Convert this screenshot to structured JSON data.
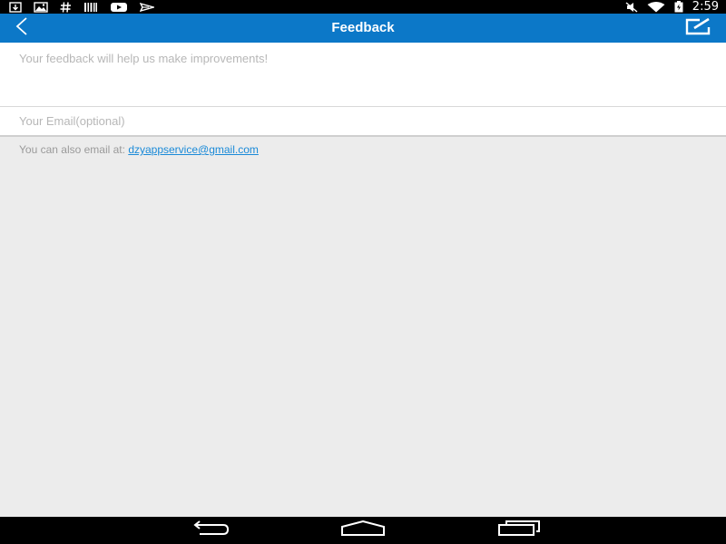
{
  "status_bar": {
    "time": "2:59",
    "left_icons": [
      "download-icon",
      "image-icon",
      "hash-icon",
      "barcode-icon",
      "youtube-icon",
      "plane-icon"
    ],
    "right_icons": [
      "mute-icon",
      "wifi-icon",
      "battery-icon"
    ]
  },
  "app_bar": {
    "title": "Feedback",
    "back_icon": "chevron-left-icon",
    "send_icon": "edit-send-icon",
    "background": "#0c78c8"
  },
  "form": {
    "feedback_placeholder": "Your feedback will help us make improvements!",
    "feedback_value": "",
    "email_placeholder": "Your Email(optional)",
    "email_value": ""
  },
  "note": {
    "prefix": "You can also email at: ",
    "email": "dzyappservice@gmail.com"
  },
  "nav_bar": {
    "buttons": [
      "back-nav-icon",
      "home-nav-icon",
      "recents-nav-icon"
    ]
  }
}
